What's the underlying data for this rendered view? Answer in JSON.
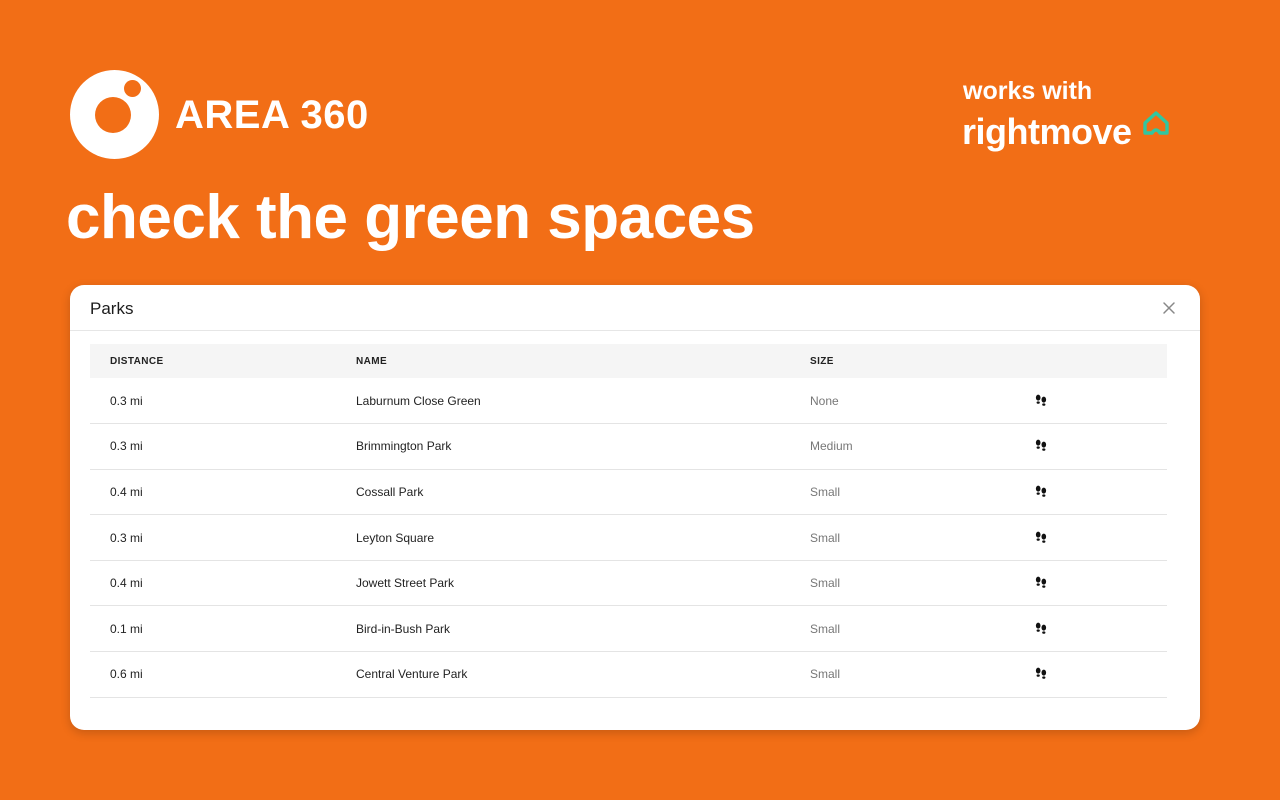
{
  "header": {
    "brand_name": "AREA 360",
    "works_with": "works with",
    "partner_name": "rightmove",
    "partner_icon": "house-outline-icon",
    "partner_icon_color": "#31C7A0"
  },
  "headline": "check the green spaces",
  "colors": {
    "background": "#F26E16",
    "panel": "#FFFFFF"
  },
  "panel": {
    "title": "Parks",
    "close_icon": "close-icon",
    "columns": [
      "DISTANCE",
      "NAME",
      "SIZE",
      ""
    ],
    "row_action_icon": "footsteps-icon",
    "rows": [
      {
        "distance": "0.3 mi",
        "name": "Laburnum Close Green",
        "size": "None"
      },
      {
        "distance": "0.3 mi",
        "name": "Brimmington Park",
        "size": "Medium"
      },
      {
        "distance": "0.4 mi",
        "name": "Cossall Park",
        "size": "Small"
      },
      {
        "distance": "0.3 mi",
        "name": "Leyton Square",
        "size": "Small"
      },
      {
        "distance": "0.4 mi",
        "name": "Jowett Street Park",
        "size": "Small"
      },
      {
        "distance": "0.1 mi",
        "name": "Bird-in-Bush Park",
        "size": "Small"
      },
      {
        "distance": "0.6 mi",
        "name": "Central Venture Park",
        "size": "Small"
      }
    ]
  }
}
